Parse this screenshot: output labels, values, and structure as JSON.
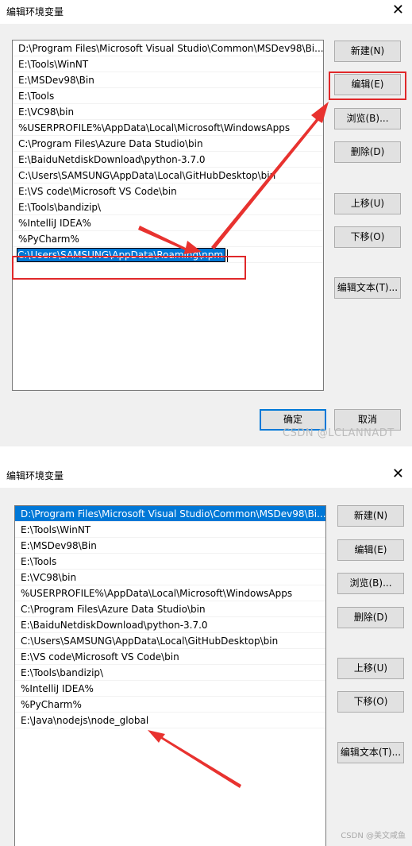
{
  "dialog1": {
    "title": "编辑环境变量",
    "close": "✕",
    "items": [
      "D:\\Program Files\\Microsoft Visual Studio\\Common\\MSDev98\\Bi...",
      "E:\\Tools\\WinNT",
      "E:\\MSDev98\\Bin",
      "E:\\Tools",
      "E:\\VC98\\bin",
      "%USERPROFILE%\\AppData\\Local\\Microsoft\\WindowsApps",
      "C:\\Program Files\\Azure Data Studio\\bin",
      "E:\\BaiduNetdiskDownload\\python-3.7.0",
      "C:\\Users\\SAMSUNG\\AppData\\Local\\GitHubDesktop\\bin",
      "E:\\VS code\\Microsoft VS Code\\bin",
      "E:\\Tools\\bandizip\\",
      "%IntelliJ IDEA%",
      "%PyCharm%"
    ],
    "editing_value": "C:\\Users\\SAMSUNG\\AppData\\Roaming\\npm",
    "buttons": {
      "new": "新建(N)",
      "edit": "编辑(E)",
      "browse": "浏览(B)...",
      "delete": "删除(D)",
      "move_up": "上移(U)",
      "move_down": "下移(O)",
      "edit_text": "编辑文本(T)...",
      "ok": "确定",
      "cancel": "取消"
    },
    "watermark": "CSDN @LCLANNADT"
  },
  "dialog2": {
    "title": "编辑环境变量",
    "close": "✕",
    "items": [
      "D:\\Program Files\\Microsoft Visual Studio\\Common\\MSDev98\\Bi...",
      "E:\\Tools\\WinNT",
      "E:\\MSDev98\\Bin",
      "E:\\Tools",
      "E:\\VC98\\bin",
      "%USERPROFILE%\\AppData\\Local\\Microsoft\\WindowsApps",
      "C:\\Program Files\\Azure Data Studio\\bin",
      "E:\\BaiduNetdiskDownload\\python-3.7.0",
      "C:\\Users\\SAMSUNG\\AppData\\Local\\GitHubDesktop\\bin",
      "E:\\VS code\\Microsoft VS Code\\bin",
      "E:\\Tools\\bandizip\\",
      "%IntelliJ IDEA%",
      "%PyCharm%",
      "E:\\Java\\nodejs\\node_global"
    ],
    "buttons": {
      "new": "新建(N)",
      "edit": "编辑(E)",
      "browse": "浏览(B)...",
      "delete": "删除(D)",
      "move_up": "上移(U)",
      "move_down": "下移(O)",
      "edit_text": "编辑文本(T)..."
    },
    "watermark": "CSDN @美文咸鱼"
  },
  "colors": {
    "highlight": "#e0282a",
    "selection": "#0078d7",
    "arrow": "#e8322f"
  }
}
